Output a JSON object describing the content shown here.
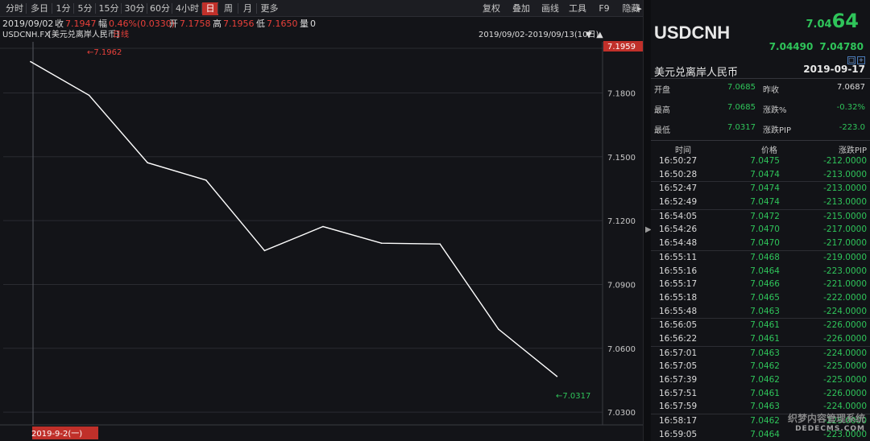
{
  "toolbar": {
    "left_items": [
      {
        "label": "分时"
      },
      {
        "label": "多日"
      },
      {
        "label": "1分"
      },
      {
        "label": "5分"
      },
      {
        "label": "15分"
      },
      {
        "label": "30分"
      },
      {
        "label": "60分"
      },
      {
        "label": "4小时"
      },
      {
        "label": "日",
        "active": true
      },
      {
        "label": "周"
      },
      {
        "label": "月"
      },
      {
        "label": "更多"
      }
    ],
    "right_items": [
      {
        "label": "复权"
      },
      {
        "label": "叠加"
      },
      {
        "label": "画线"
      },
      {
        "label": "工具"
      },
      {
        "label": "F9"
      },
      {
        "label": "隐藏"
      }
    ],
    "hide_arrow": "▸"
  },
  "info_bar": {
    "date": "2019/09/02",
    "close_label": "收",
    "close_value": "7.1947",
    "range_label": "幅",
    "range_value": "0.46%(0.0330)",
    "open_label": "开",
    "open_value": "7.1758",
    "high_label": "高",
    "high_value": "7.1956",
    "low_label": "低",
    "low_value": "7.1650",
    "volume_label": "量",
    "volume_value": "0"
  },
  "symbol_bar": {
    "code": "USDCNH.FX",
    "name": "[美元兑离岸人民币]",
    "period": "日线",
    "date_range": "2019/09/02-2019/09/13(10日)",
    "arrow_down": "▼",
    "arrow_up": "▲"
  },
  "chart_data": {
    "type": "line",
    "x": [
      "2019-09-02",
      "2019-09-03",
      "2019-09-04",
      "2019-09-05",
      "2019-09-06",
      "2019-09-09",
      "2019-09-10",
      "2019-09-11",
      "2019-09-12",
      "2019-09-13"
    ],
    "y": [
      7.1947,
      7.1789,
      7.1472,
      7.139,
      7.1059,
      7.1172,
      7.1094,
      7.109,
      7.069,
      7.0468
    ],
    "ylim": [
      7.024,
      7.204
    ],
    "yticks": [
      7.18,
      7.15,
      7.12,
      7.09,
      7.06,
      7.03
    ],
    "ytick_labels": [
      "7.1800",
      "7.1500",
      "7.1200",
      "7.0900",
      "7.0600",
      "7.0300"
    ],
    "current_value_label": "7.1959",
    "max_marker": "7.1962",
    "min_marker": "7.0317",
    "marker_arrow": "←",
    "x_cursor_label": "2019-9-2(一)",
    "grid": true,
    "colors": {
      "line": "#ffffff",
      "grid": "#2a2b31",
      "axis_text": "#c8c8c8",
      "highlight": "#c0302a"
    }
  },
  "panel": {
    "symbol": "USDCNH",
    "price_prefix": "7.04",
    "price_big": "64",
    "bid": "7.04490",
    "ask": "7.04780",
    "name_cn": "美元兑离岸人民币",
    "date": "2019-09-17",
    "mini_btn_1": "□",
    "mini_btn_2": "+",
    "stats": [
      {
        "label": "开盘",
        "value": "7.0685",
        "label2": "昨收",
        "value2": "7.0687",
        "value2_color": "#dcdcdc"
      },
      {
        "label": "最高",
        "value": "7.0685",
        "label2": "涨跌%",
        "value2": "-0.32%",
        "value2_color": "#2fc45a"
      },
      {
        "label": "最低",
        "value": "7.0317",
        "label2": "涨跌PIP",
        "value2": "-223.0",
        "value2_color": "#2fc45a"
      }
    ],
    "trades_header": {
      "time": "时间",
      "price": "价格",
      "change": "涨跌PIP"
    },
    "trade_groups": [
      [
        {
          "time": "16:50:27",
          "price": "7.0475",
          "change": "-212.0000"
        },
        {
          "time": "16:50:28",
          "price": "7.0474",
          "change": "-213.0000"
        }
      ],
      [
        {
          "time": "16:52:47",
          "price": "7.0474",
          "change": "-213.0000"
        },
        {
          "time": "16:52:49",
          "price": "7.0474",
          "change": "-213.0000"
        }
      ],
      [
        {
          "time": "16:54:05",
          "price": "7.0472",
          "change": "-215.0000"
        },
        {
          "time": "16:54:26",
          "price": "7.0470",
          "change": "-217.0000"
        },
        {
          "time": "16:54:48",
          "price": "7.0470",
          "change": "-217.0000"
        }
      ],
      [
        {
          "time": "16:55:11",
          "price": "7.0468",
          "change": "-219.0000"
        },
        {
          "time": "16:55:16",
          "price": "7.0464",
          "change": "-223.0000"
        },
        {
          "time": "16:55:17",
          "price": "7.0466",
          "change": "-221.0000"
        },
        {
          "time": "16:55:18",
          "price": "7.0465",
          "change": "-222.0000"
        },
        {
          "time": "16:55:48",
          "price": "7.0463",
          "change": "-224.0000"
        }
      ],
      [
        {
          "time": "16:56:05",
          "price": "7.0461",
          "change": "-226.0000"
        },
        {
          "time": "16:56:22",
          "price": "7.0461",
          "change": "-226.0000"
        }
      ],
      [
        {
          "time": "16:57:01",
          "price": "7.0463",
          "change": "-224.0000"
        },
        {
          "time": "16:57:05",
          "price": "7.0462",
          "change": "-225.0000"
        },
        {
          "time": "16:57:39",
          "price": "7.0462",
          "change": "-225.0000"
        },
        {
          "time": "16:57:51",
          "price": "7.0461",
          "change": "-226.0000"
        },
        {
          "time": "16:57:59",
          "price": "7.0463",
          "change": "-224.0000"
        }
      ],
      [
        {
          "time": "16:58:17",
          "price": "7.0462",
          "change": "-225.0000"
        },
        {
          "time": "16:59:05",
          "price": "7.0464",
          "change": "-223.0000"
        }
      ]
    ]
  },
  "watermark": {
    "line1": "织梦内容管理系统",
    "line2": "DEDECMS.COM"
  }
}
